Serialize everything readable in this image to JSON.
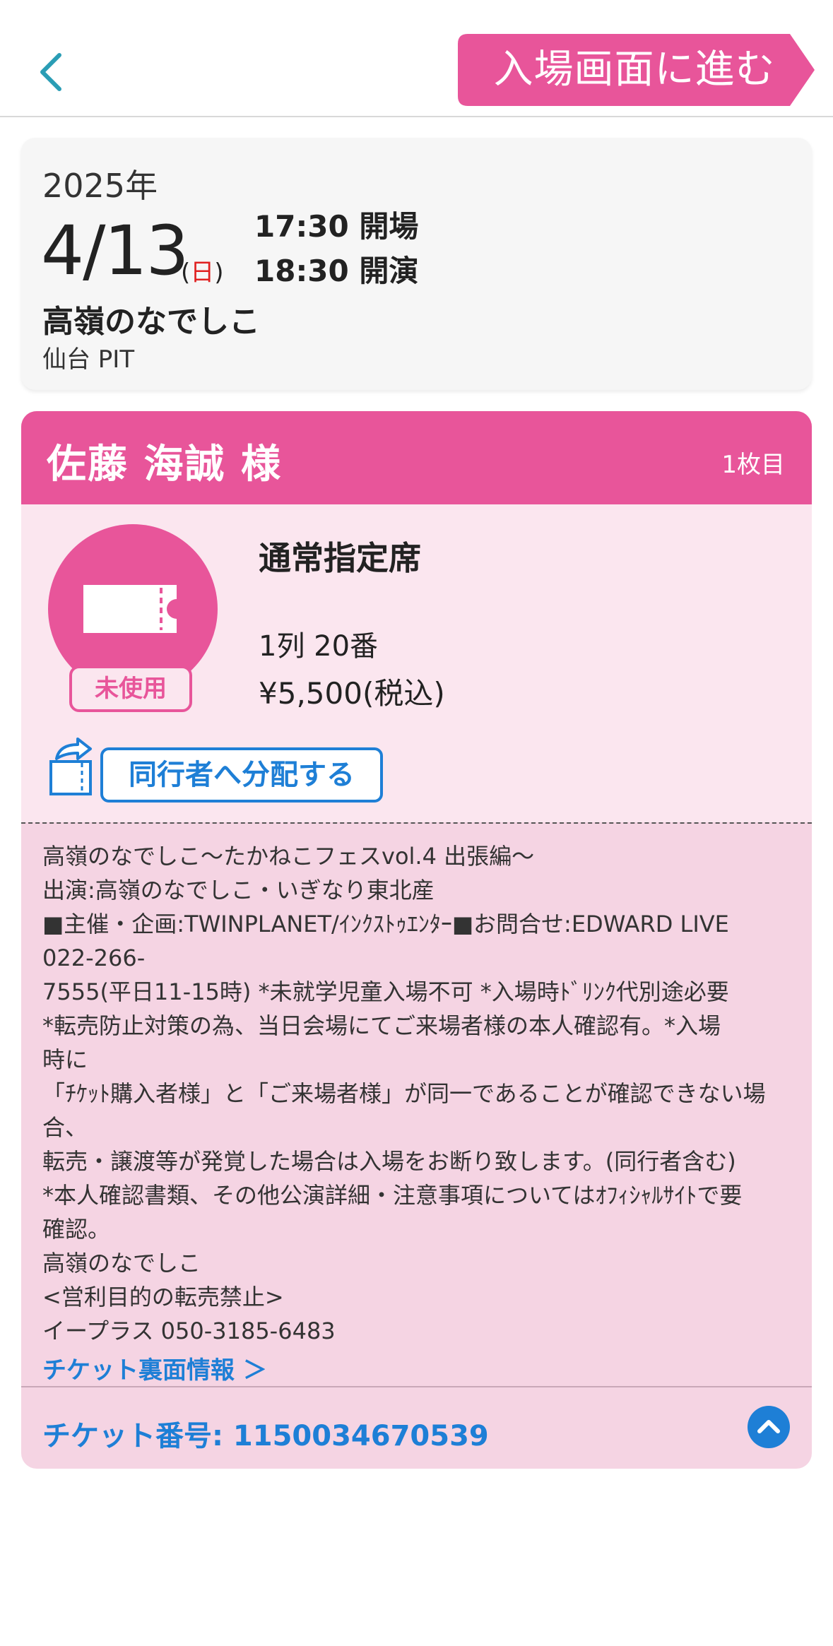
{
  "header": {
    "enter_button_label": "入場画面に進む"
  },
  "event": {
    "year": "2025年",
    "date": "4/13",
    "weekday_open": "(",
    "weekday": "日",
    "weekday_close": ")",
    "open_time": "17:30 開場",
    "start_time": "18:30 開演",
    "title": "高嶺のなでしこ",
    "venue": "仙台 PIT"
  },
  "ticket": {
    "holder_name": "佐藤 海誠 様",
    "ticket_count": "1枚目",
    "status_badge": "未使用",
    "seat_type": "通常指定席",
    "seat_number": "1列 20番",
    "price": "¥5,500(税込)",
    "share_button_label": "同行者へ分配する",
    "notes": [
      "高嶺のなでしこ〜たかねこフェスvol.4 出張編〜",
      "出演:高嶺のなでしこ・いぎなり東北産",
      "■主催・企画:TWINPLANET/ｲﾝｸｽﾄｩｴﾝﾀｰ■お問合せ:EDWARD LIVE",
      "022-266-",
      "7555(平日11-15時) *未就学児童入場不可 *入場時ﾄﾞﾘﾝｸ代別途必要",
      "*転売防止対策の為、当日会場にてご来場者様の本人確認有。*入場",
      "時に",
      "「ﾁｹｯﾄ購入者様」と「ご来場者様」が同一であることが確認できない場",
      "合、",
      "転売・譲渡等が発覚した場合は入場をお断り致します。(同行者含む)",
      "*本人確認書類、その他公演詳細・注意事項についてはｵﾌｨｼｬﾙｻｲﾄで要",
      "確認。",
      "高嶺のなでしこ",
      "<営利目的の転売禁止>",
      "イープラス 050-3185-6483"
    ],
    "back_info_link": "チケット裏面情報 ＞",
    "ticket_number": "チケット番号: 1150034670539"
  },
  "colors": {
    "brand_pink": "#e8559a",
    "light_pink": "#fbe6ef",
    "notes_pink": "#f5d4e3",
    "link_blue": "#1e7fd6"
  },
  "icons": {
    "back": "chevron-left-icon",
    "ticket": "ticket-icon",
    "share": "share-arrow-icon",
    "collapse": "chevron-up-icon"
  }
}
